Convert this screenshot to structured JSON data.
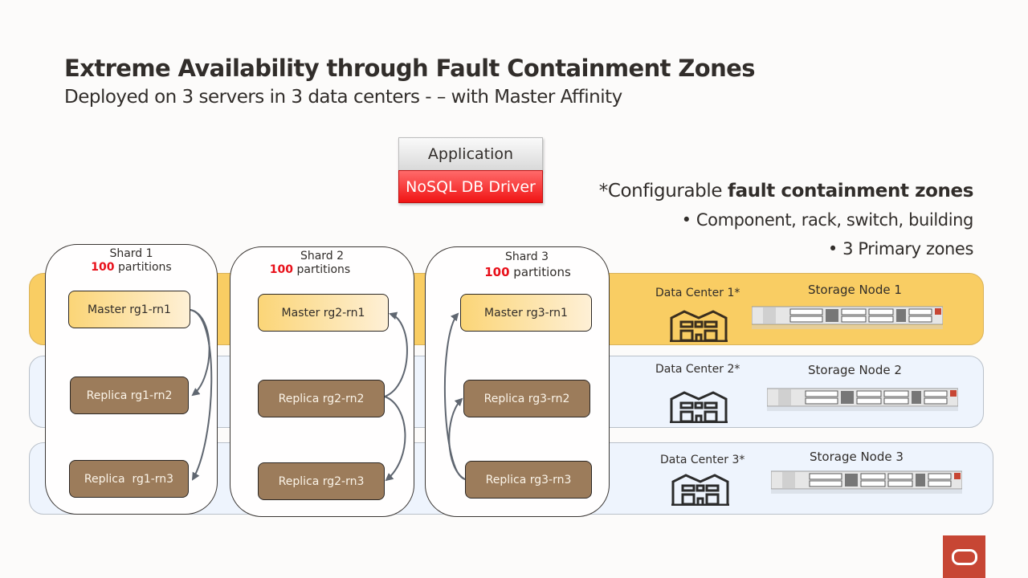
{
  "header": {
    "title": "Extreme Availability through Fault Containment Zones",
    "subtitle": "Deployed on 3 servers in 3 data centers - – with Master Affinity"
  },
  "client_stack": {
    "application_label": "Application",
    "driver_label": "NoSQL DB Driver"
  },
  "notes": {
    "headline_prefix": "*Configurable ",
    "headline_bold": "fault containment zones",
    "bullets": [
      "•  Component, rack, switch, building",
      "•  3 Primary zones"
    ]
  },
  "shards": [
    {
      "title": "Shard 1",
      "partitions_count": "100",
      "partitions_label": " partitions",
      "master": "Master rg1-rn1",
      "replicas": [
        "Replica rg1-rn2",
        "Replica  rg1-rn3"
      ]
    },
    {
      "title": "Shard 2",
      "partitions_count": "100",
      "partitions_label": " partitions",
      "master": "Master rg2-rn1",
      "replicas": [
        "Replica rg2-rn2",
        "Replica rg2-rn3"
      ]
    },
    {
      "title": "Shard 3",
      "partitions_count": "100",
      "partitions_label": " partitions",
      "master": "Master rg3-rn1",
      "replicas": [
        "Replica rg3-rn2",
        "Replica rg3-rn3"
      ]
    }
  ],
  "zones": [
    {
      "data_center": "Data Center 1*",
      "storage_node": "Storage Node 1",
      "color": "#f9cd63"
    },
    {
      "data_center": "Data Center 2*",
      "storage_node": "Storage Node 2",
      "color": "#eef4fd"
    },
    {
      "data_center": "Data Center 3*",
      "storage_node": "Storage Node 3",
      "color": "#eef4fd"
    }
  ],
  "colors": {
    "accent_red": "#e8101a",
    "replica_brown": "#9c7c5b",
    "arrow_gray": "#5f6670",
    "brand_red": "#c74634"
  },
  "brand": {
    "logo": "oracle-logo-icon"
  }
}
